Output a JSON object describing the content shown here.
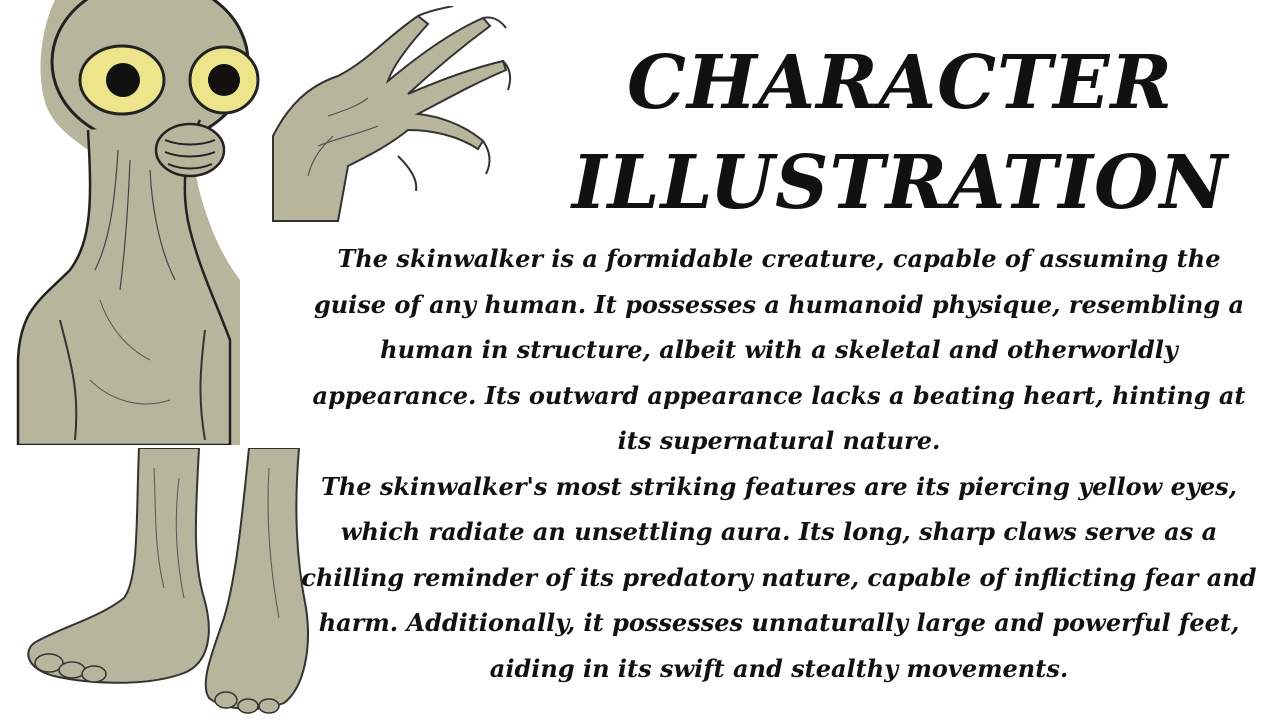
{
  "page": {
    "title_line1": "CHARACTER",
    "title_line2": "ILLUSTRATION",
    "paragraphs": [
      "The skinwalker is a formidable creature, capable of assuming the guise of any human. It possesses a humanoid physique, resembling a human in structure, albeit with a skeletal and otherworldly appearance. Its outward appearance lacks a beating heart, hinting at its supernatural nature.",
      "The skinwalker's most striking features are its piercing yellow eyes, which radiate an unsettling aura. Its long, sharp claws serve as a chilling reminder of its predatory nature, capable of inflicting fear and harm. Additionally, it possesses unnaturally large and powerful feet, aiding in its swift and stealthy movements."
    ]
  },
  "colors": {
    "skin": "#b7b69c",
    "eye": "#ece58c",
    "text": "#111111"
  }
}
